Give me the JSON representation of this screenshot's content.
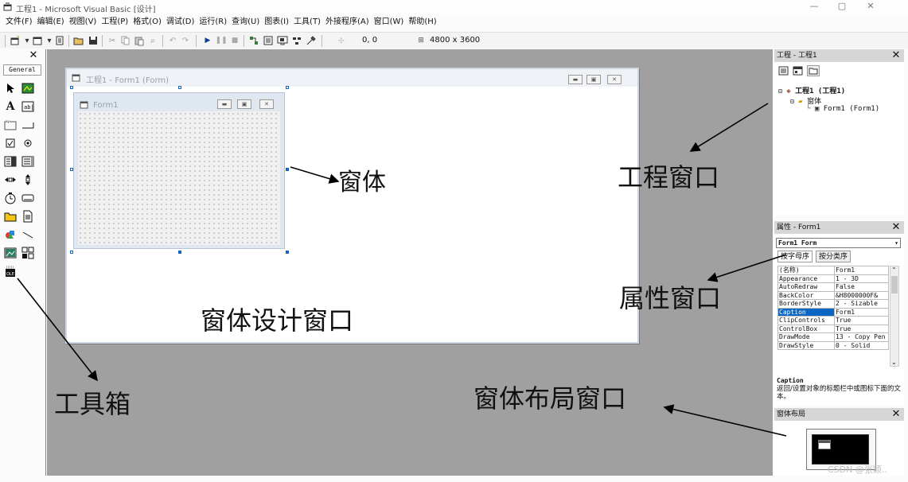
{
  "window": {
    "title": "工程1 - Microsoft Visual Basic [设计]",
    "controls": {
      "minimize": "—",
      "maximize": "▢",
      "close": "✕"
    }
  },
  "menu": [
    "文件(F)",
    "编辑(E)",
    "视图(V)",
    "工程(P)",
    "格式(O)",
    "调试(D)",
    "运行(R)",
    "查询(U)",
    "图表(I)",
    "工具(T)",
    "外接程序(A)",
    "窗口(W)",
    "帮助(H)"
  ],
  "toolbar": {
    "position": "0, 0",
    "size": "4800 x 3600"
  },
  "toolbox": {
    "close": "✕",
    "tab": "General"
  },
  "designer": {
    "title": "工程1 - Form1 (Form)"
  },
  "form": {
    "title": "Form1"
  },
  "project_panel": {
    "title": "工程 - 工程1",
    "close": "✕",
    "tree": [
      "工程1 (工程1)",
      "窗体",
      "Form1 (Form1)"
    ]
  },
  "properties_panel": {
    "title": "属性 - Form1",
    "close": "✕",
    "object": "Form1 Form",
    "tabs": [
      "按字母序",
      "按分类序"
    ],
    "rows": [
      {
        "name": "(名称)",
        "value": "Form1"
      },
      {
        "name": "Appearance",
        "value": "1 - 3D"
      },
      {
        "name": "AutoRedraw",
        "value": "False"
      },
      {
        "name": "BackColor",
        "value": "&H8000000F&"
      },
      {
        "name": "BorderStyle",
        "value": "2 - Sizable"
      },
      {
        "name": "Caption",
        "value": "Form1"
      },
      {
        "name": "ClipControls",
        "value": "True"
      },
      {
        "name": "ControlBox",
        "value": "True"
      },
      {
        "name": "DrawMode",
        "value": "13 - Copy Pen"
      },
      {
        "name": "DrawStyle",
        "value": "0 - Solid"
      }
    ],
    "selected": "Caption",
    "desc_name": "Caption",
    "desc_text": "返回/设置对象的标题栏中或图标下面的文本。"
  },
  "layout_panel": {
    "title": "窗体布局",
    "close": "✕"
  },
  "annotations": {
    "form": "窗体",
    "designer": "窗体设计窗口",
    "toolbox": "工具箱",
    "project": "工程窗口",
    "properties": "属性窗口",
    "layout": "窗体布局窗口"
  },
  "watermark": "CSDN @张颖.."
}
